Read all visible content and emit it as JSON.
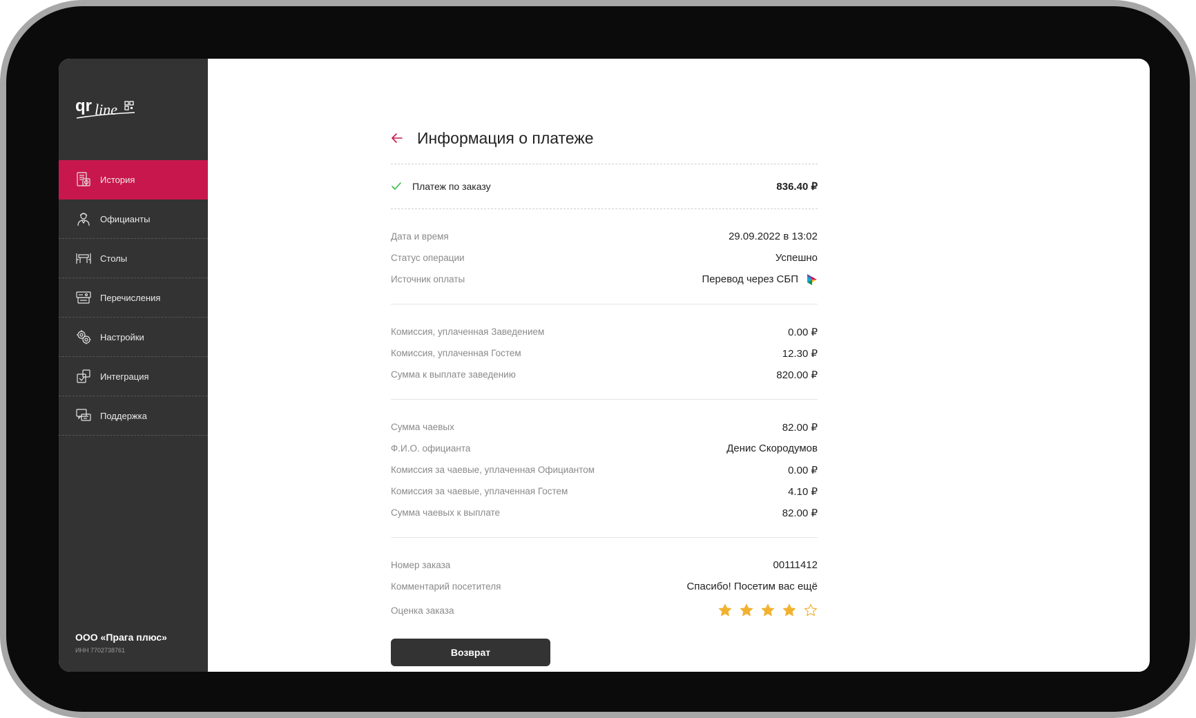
{
  "sidebar": {
    "items": [
      {
        "label": "История",
        "active": true
      },
      {
        "label": "Официанты"
      },
      {
        "label": "Столы"
      },
      {
        "label": "Перечисления"
      },
      {
        "label": "Настройки"
      },
      {
        "label": "Интеграция"
      },
      {
        "label": "Поддержка"
      }
    ],
    "org": {
      "name": "ООО «Прага плюс»",
      "inn": "ИНН 7702738761"
    }
  },
  "page": {
    "title": "Информация о платеже"
  },
  "order": {
    "label": "Платеж по заказу",
    "amount": "836.40 ₽"
  },
  "details": {
    "date_label": "Дата и время",
    "date_value": "29.09.2022 в 13:02",
    "status_label": "Статус операции",
    "status_value": "Успешно",
    "source_label": "Источник оплаты",
    "source_value": "Перевод через СБП"
  },
  "commission": {
    "venue_label": "Комиссия, уплаченная Заведением",
    "venue_value": "0.00 ₽",
    "guest_label": "Комиссия, уплаченная Гостем",
    "guest_value": "12.30 ₽",
    "payout_label": "Сумма к выплате заведению",
    "payout_value": "820.00 ₽"
  },
  "tips": {
    "sum_label": "Сумма чаевых",
    "sum_value": "82.00 ₽",
    "waiter_label": "Ф.И.О. официанта",
    "waiter_value": "Денис Скородумов",
    "waiter_fee_label": "Комиссия за чаевые, уплаченная Официантом",
    "waiter_fee_value": "0.00 ₽",
    "guest_fee_label": "Комиссия за чаевые, уплаченная Гостем",
    "guest_fee_value": "4.10 ₽",
    "payout_label": "Сумма чаевых к выплате",
    "payout_value": "82.00 ₽"
  },
  "meta": {
    "order_no_label": "Номер заказа",
    "order_no_value": "00111412",
    "comment_label": "Комментарий посетителя",
    "comment_value": "Спасибо! Посетим вас ещё",
    "rating_label": "Оценка заказа",
    "rating": 4,
    "rating_max": 5
  },
  "actions": {
    "refund_label": "Возврат"
  },
  "colors": {
    "accent": "#c8174c",
    "sidebar": "#333333",
    "star": "#f2b230",
    "success": "#3bb54a"
  },
  "icons": [
    "history-icon",
    "waiter-icon",
    "table-icon",
    "transfer-icon",
    "settings-icon",
    "integration-icon",
    "support-icon",
    "back-arrow-icon",
    "check-icon",
    "sbp-icon",
    "star-icon"
  ]
}
